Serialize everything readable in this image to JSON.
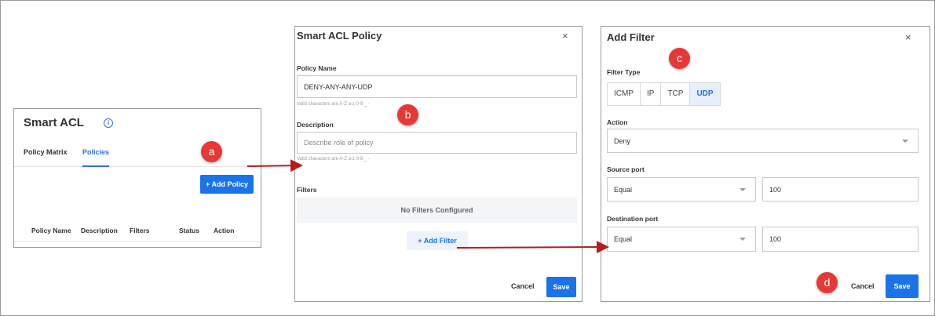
{
  "panel_a": {
    "title": "Smart ACL",
    "tabs": [
      {
        "label": "Policy Matrix"
      },
      {
        "label": "Policies"
      }
    ],
    "add_button": "+ Add Policy",
    "columns": [
      "Policy Name",
      "Description",
      "Filters",
      "Status",
      "Action"
    ]
  },
  "panel_b": {
    "title": "Smart ACL Policy",
    "close": "×",
    "policy_name_label": "Policy Name",
    "policy_name_value": "DENY-ANY-ANY-UDP",
    "policy_name_hint": "Valid characters are A-Z a-z 0-9 _ -",
    "description_label": "Description",
    "description_placeholder": "Describe role of policy",
    "description_hint": "Valid characters are A-Z a-z 0-9 _ -",
    "filters_label": "Filters",
    "empty_text": "No Filters Configured",
    "add_filter": "+ Add Filter",
    "cancel": "Cancel",
    "save": "Save"
  },
  "panel_c": {
    "title": "Add Filter",
    "close": "×",
    "filter_type_label": "Filter Type",
    "filter_types": [
      "ICMP",
      "IP",
      "TCP",
      "UDP"
    ],
    "selected_filter_type": "UDP",
    "action_label": "Action",
    "action_value": "Deny",
    "source_port_label": "Source port",
    "source_operator": "Equal",
    "source_value": "100",
    "destination_port_label": "Destination port",
    "destination_operator": "Equal",
    "destination_value": "100",
    "cancel": "Cancel",
    "save": "Save"
  },
  "badges": [
    "a",
    "b",
    "c",
    "d"
  ],
  "colors": {
    "accent": "#1a73e8",
    "badge": "#e53935",
    "arrow": "#b71c1c"
  }
}
